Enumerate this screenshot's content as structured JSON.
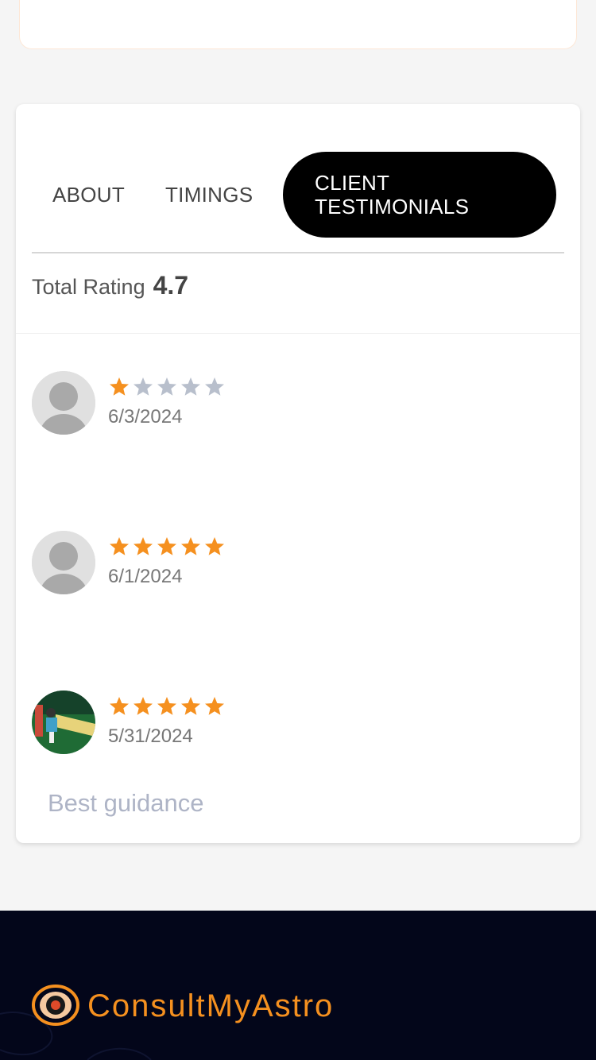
{
  "tabs": [
    {
      "label": "ABOUT",
      "active": false
    },
    {
      "label": "TIMINGS",
      "active": false
    },
    {
      "label": "CLIENT TESTIMONIALS",
      "active": true
    }
  ],
  "rating": {
    "label": "Total Rating",
    "value": "4.7"
  },
  "colors": {
    "star_filled": "#f5901f",
    "star_empty": "#b8bfcc",
    "brand": "#f5901f",
    "footer_bg": "#03061a"
  },
  "reviews": [
    {
      "stars": 1,
      "max_stars": 5,
      "date": "6/3/2024",
      "text": "",
      "avatar": "default-avatar-icon"
    },
    {
      "stars": 5,
      "max_stars": 5,
      "date": "6/1/2024",
      "text": "",
      "avatar": "default-avatar-icon"
    },
    {
      "stars": 5,
      "max_stars": 5,
      "date": "5/31/2024",
      "text": "Best guidance",
      "avatar": "user-photo"
    }
  ],
  "footer": {
    "brand": "ConsultMyAstro",
    "logo": "astro-logo-icon"
  }
}
